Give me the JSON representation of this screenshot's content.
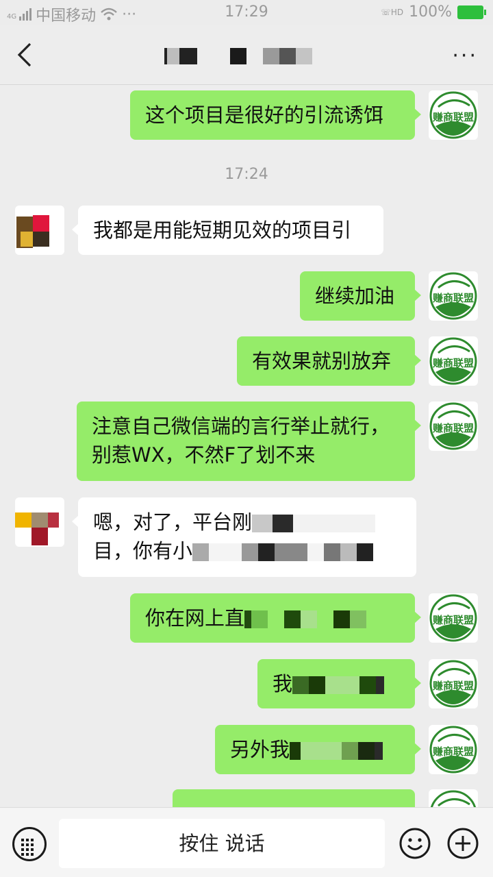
{
  "status_bar": {
    "network": "4G",
    "carrier": "中国移动",
    "more": "···",
    "time": "17:29",
    "hd": "HD",
    "battery": "100%"
  },
  "header": {
    "more": "···"
  },
  "messages": [
    {
      "side": "me",
      "text": "这个项目是很好的引流诱饵"
    },
    {
      "type": "time",
      "text": "17:24"
    },
    {
      "side": "them",
      "text": "我都是用能短期见效的项目引"
    },
    {
      "side": "me",
      "text": "继续加油"
    },
    {
      "side": "me",
      "text": "有效果就别放弃"
    },
    {
      "side": "me",
      "line1": "注意自己微信端的言行举止就行，",
      "line2": "别惹WX，不然F了划不来"
    },
    {
      "side": "them",
      "line1": "嗯，对了，平台刚",
      "line2": "目，你有小"
    },
    {
      "side": "me",
      "text": "你在网上直"
    },
    {
      "side": "me",
      "text": "我"
    },
    {
      "side": "me",
      "text": "另外我"
    }
  ],
  "brand_avatar_text": "赚商联盟",
  "input": {
    "talk_label": "按住 说话"
  }
}
